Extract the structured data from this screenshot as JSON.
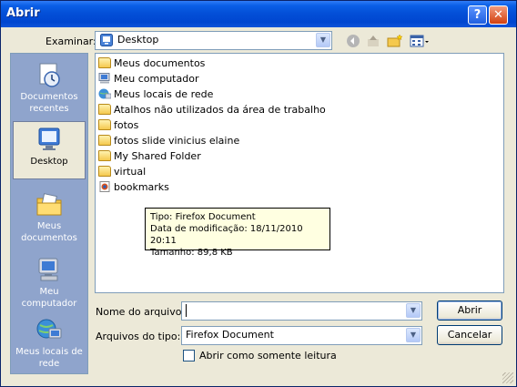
{
  "window": {
    "title": "Abrir",
    "help_label": "?",
    "close_label": "✕"
  },
  "lookin": {
    "label": "Examinar:",
    "value": "Desktop"
  },
  "toolbar": {
    "icons": [
      "back-icon",
      "up-folder-icon",
      "new-folder-icon",
      "view-menu-icon"
    ]
  },
  "places": [
    {
      "label": "Documentos recentes",
      "icon": "recent-documents-icon"
    },
    {
      "label": "Desktop",
      "icon": "desktop-icon",
      "selected": true
    },
    {
      "label": "Meus documentos",
      "icon": "my-documents-icon"
    },
    {
      "label": "Meu computador",
      "icon": "my-computer-icon"
    },
    {
      "label": "Meus locais de rede",
      "icon": "network-places-icon"
    }
  ],
  "files": [
    {
      "name": "Meus documentos",
      "icon": "my-documents-icon"
    },
    {
      "name": "Meu computador",
      "icon": "my-computer-icon"
    },
    {
      "name": "Meus locais de rede",
      "icon": "network-places-icon"
    },
    {
      "name": "Atalhos não utilizados da área de trabalho",
      "icon": "folder-icon"
    },
    {
      "name": "fotos",
      "icon": "folder-icon"
    },
    {
      "name": "fotos slide vinicius elaine",
      "icon": "folder-icon"
    },
    {
      "name": "My Shared Folder",
      "icon": "shared-folder-icon"
    },
    {
      "name": "virtual",
      "icon": "folder-icon"
    },
    {
      "name": "bookmarks",
      "icon": "firefox-document-icon"
    }
  ],
  "tooltip": {
    "line1": "Tipo: Firefox Document",
    "line2": "Data de modificação: 18/11/2010 20:11",
    "line3": "Tamanho: 89,8 KB"
  },
  "filename": {
    "label": "Nome do arquivo:",
    "value": ""
  },
  "filetype": {
    "label": "Arquivos do tipo:",
    "value": "Firefox Document"
  },
  "readonly": {
    "label": "Abrir como somente leitura",
    "checked": false
  },
  "buttons": {
    "open": "Abrir",
    "cancel": "Cancelar"
  },
  "colors": {
    "title_bar": "#0450d8",
    "places_bar": "#8fa4cc",
    "dialog_bg": "#ece9d8",
    "tooltip_bg": "#ffffe1"
  }
}
